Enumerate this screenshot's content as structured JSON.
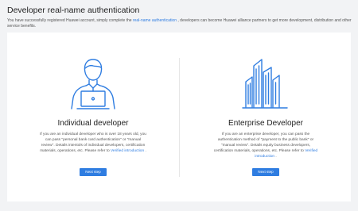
{
  "page": {
    "title": "Developer real-name authentication",
    "intro_before": "You have successfully registered Huawei account, simply complete the ",
    "intro_link": "real-name authentication",
    "intro_after": " , developers can become Huawei alliance partners to get more development, distribution and other service benefits."
  },
  "individual": {
    "illustration_icon": "person-laptop-icon",
    "title": "Individual developer",
    "description": "If you are an individual developer who is over 18 years old, you can pass \"personal bank card authentication\" or \"manual review\". Details intentols of individual developers, certification materials, operations, etc. Please refer to ",
    "link": "Verified introduction",
    "description_end": " .",
    "button": "Next step"
  },
  "enterprise": {
    "illustration_icon": "office-buildings-icon",
    "title": "Enterprise Developer",
    "description": "If you are an enterprise developer, you can pass the authentication method of \"payment to the public bank\" or \"manual review\". Details equity business developers, certification materials, operations, etc. Please refer to ",
    "link": "Verified introduction",
    "description_end": " .",
    "button": "Next step"
  },
  "colors": {
    "accent": "#2f7de1",
    "background": "#f2f3f5",
    "panel": "#ffffff"
  }
}
